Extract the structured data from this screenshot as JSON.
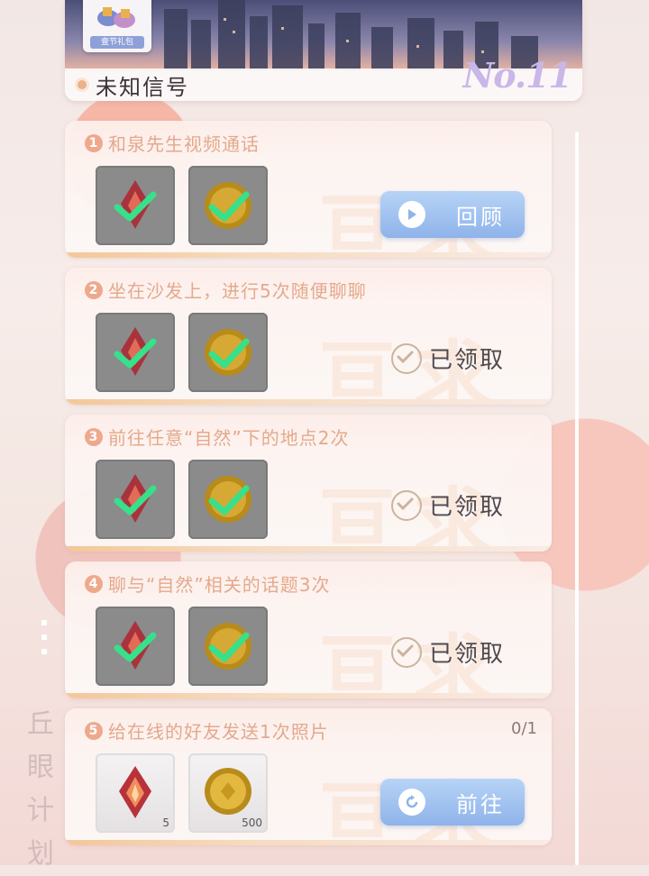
{
  "banner": {
    "card_tag": "壹节礼包",
    "title": "未知信号",
    "number": "No.11"
  },
  "side_label": "丘眼计划",
  "tasks": [
    {
      "index": "1",
      "title": "和泉先生视频通话",
      "status": "button",
      "button_label": "回顾",
      "progress": "",
      "rewards": [
        {
          "icon": "red-crystal-icon",
          "qty": "",
          "claimed": true
        },
        {
          "icon": "gold-coin-icon",
          "qty": "",
          "claimed": true
        }
      ]
    },
    {
      "index": "2",
      "title": "坐在沙发上，进行5次随便聊聊",
      "status": "claimed",
      "claimed_label": "已领取",
      "progress": "",
      "rewards": [
        {
          "icon": "red-crystal-icon",
          "qty": "",
          "claimed": true
        },
        {
          "icon": "gold-coin-icon",
          "qty": "",
          "claimed": true
        }
      ]
    },
    {
      "index": "3",
      "title": "前往任意“自然”下的地点2次",
      "status": "claimed",
      "claimed_label": "已领取",
      "progress": "",
      "rewards": [
        {
          "icon": "red-crystal-icon",
          "qty": "",
          "claimed": true
        },
        {
          "icon": "gold-coin-icon",
          "qty": "",
          "claimed": true
        }
      ]
    },
    {
      "index": "4",
      "title": "聊与“自然”相关的话题3次",
      "status": "claimed",
      "claimed_label": "已领取",
      "progress": "",
      "rewards": [
        {
          "icon": "red-crystal-icon",
          "qty": "",
          "claimed": true
        },
        {
          "icon": "gold-coin-icon",
          "qty": "",
          "claimed": true
        }
      ]
    },
    {
      "index": "5",
      "title": "给在线的好友发送1次照片",
      "status": "button",
      "button_label": "前往",
      "progress": "0/1",
      "rewards": [
        {
          "icon": "red-crystal-icon",
          "qty": "5",
          "claimed": false
        },
        {
          "icon": "gold-coin-icon",
          "qty": "500",
          "claimed": false
        }
      ]
    }
  ],
  "colors": {
    "accent": "#e4a98c",
    "button": "#8fb3ea",
    "check": "#37e08a"
  }
}
